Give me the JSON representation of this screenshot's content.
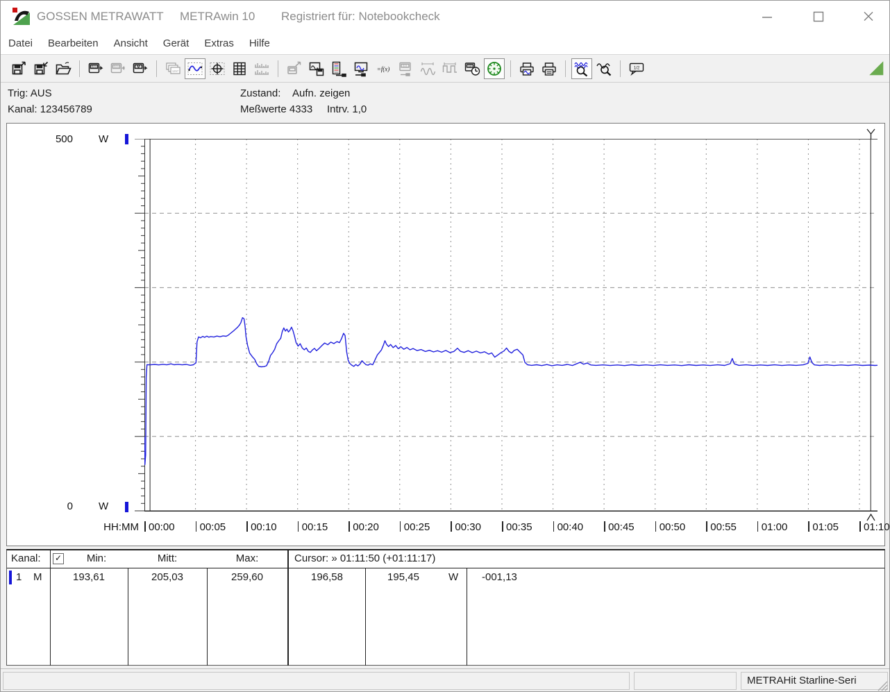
{
  "window": {
    "brand": "GOSSEN METRAWATT",
    "app_title": "METRAwin 10",
    "registered": "Registriert für: Notebookcheck"
  },
  "menu": {
    "items": [
      "Datei",
      "Bearbeiten",
      "Ansicht",
      "Gerät",
      "Extras",
      "Hilfe"
    ]
  },
  "toolbar": {
    "groups": [
      [
        {
          "name": "save-as",
          "icon": "disk_out",
          "state": "normal"
        },
        {
          "name": "save",
          "icon": "disk_in",
          "state": "normal"
        },
        {
          "name": "open",
          "icon": "folder",
          "state": "normal"
        }
      ],
      [
        {
          "name": "read-device",
          "icon": "dev321_out",
          "state": "normal"
        },
        {
          "name": "write-device",
          "icon": "dev321_in",
          "state": "disabled"
        },
        {
          "name": "read-memory",
          "icon": "devM",
          "state": "normal"
        }
      ],
      [
        {
          "name": "multi-display",
          "icon": "multidisp",
          "state": "disabled"
        },
        {
          "name": "curve-view",
          "icon": "curve",
          "state": "pressed"
        },
        {
          "name": "xy-view",
          "icon": "cross",
          "state": "normal"
        },
        {
          "name": "table-view",
          "icon": "table",
          "state": "normal"
        },
        {
          "name": "histogram-view",
          "icon": "hist",
          "state": "disabled"
        }
      ],
      [
        {
          "name": "export-device",
          "icon": "transfer",
          "state": "disabled"
        },
        {
          "name": "store-device",
          "icon": "store",
          "state": "normal"
        },
        {
          "name": "channel-setup",
          "icon": "chconf",
          "state": "normal"
        },
        {
          "name": "device-monitor",
          "icon": "monconf",
          "state": "normal"
        },
        {
          "name": "formula",
          "icon": "fx",
          "state": "normal"
        },
        {
          "name": "device-config",
          "icon": "dev321b",
          "state": "disabled"
        },
        {
          "name": "analog-trigger",
          "icon": "sine",
          "state": "disabled"
        },
        {
          "name": "pulse-trigger",
          "icon": "square",
          "state": "disabled"
        },
        {
          "name": "interval-clock",
          "icon": "clock",
          "state": "normal"
        },
        {
          "name": "live-gauge",
          "icon": "gauge",
          "state": "pressed"
        }
      ],
      [
        {
          "name": "print-preview",
          "icon": "printprev",
          "state": "normal"
        },
        {
          "name": "print",
          "icon": "print",
          "state": "normal"
        }
      ],
      [
        {
          "name": "zoom-in",
          "icon": "zoomin",
          "state": "pressed"
        },
        {
          "name": "zoom-out",
          "icon": "zoomout",
          "state": "normal"
        }
      ],
      [
        {
          "name": "value-callout",
          "icon": "callout",
          "state": "normal"
        }
      ]
    ],
    "corner_triangle_color": "#6aab4f"
  },
  "info": {
    "trig": "Trig: AUS",
    "kanal": "Kanal: 123456789",
    "zustand_label": "Zustand:",
    "zustand_value": "Aufn. zeigen",
    "messwerte": "Meßwerte 4333",
    "intervall": "Intrv. 1,0"
  },
  "chart_data": {
    "type": "line",
    "title": "",
    "xlabel": "HH:MM",
    "ylabel": "W",
    "unit": "W",
    "ylim": [
      0,
      500
    ],
    "y_top_label": "500",
    "y_bottom_label": "0",
    "grid": true,
    "x_total_min": 71.77,
    "x_tick_interval_min": 5,
    "x_ticks": [
      "00:00",
      "00:05",
      "00:10",
      "00:15",
      "00:20",
      "00:25",
      "00:30",
      "00:35",
      "00:40",
      "00:45",
      "00:50",
      "00:55",
      "01:00",
      "01:05",
      "01:10"
    ],
    "cursors_min": [
      0.55,
      71.1
    ],
    "series": [
      {
        "name": "Kanal 1 (M)",
        "color": "#2020dd",
        "points": [
          [
            0.0,
            100
          ],
          [
            0.05,
            62
          ],
          [
            0.12,
            75
          ],
          [
            0.18,
            180
          ],
          [
            0.25,
            196.5
          ],
          [
            0.6,
            196.3
          ],
          [
            1.0,
            196.8
          ],
          [
            1.4,
            196.2
          ],
          [
            1.8,
            196.9
          ],
          [
            2.2,
            196.3
          ],
          [
            2.6,
            197.6
          ],
          [
            2.9,
            196.4
          ],
          [
            3.3,
            196.9
          ],
          [
            3.7,
            196.3
          ],
          [
            4.1,
            196.8
          ],
          [
            4.5,
            195.6
          ],
          [
            4.8,
            196.4
          ],
          [
            5.05,
            199
          ],
          [
            5.15,
            227
          ],
          [
            5.3,
            233.8
          ],
          [
            5.5,
            232.6
          ],
          [
            5.7,
            234.4
          ],
          [
            5.9,
            233.2
          ],
          [
            6.1,
            234.8
          ],
          [
            6.3,
            233.4
          ],
          [
            6.5,
            234.2
          ],
          [
            6.8,
            233.6
          ],
          [
            7.1,
            234.9
          ],
          [
            7.4,
            234.0
          ],
          [
            7.7,
            235.2
          ],
          [
            8.0,
            234.6
          ],
          [
            8.2,
            236.0
          ],
          [
            8.45,
            238.8
          ],
          [
            8.7,
            241.5
          ],
          [
            8.9,
            244.0
          ],
          [
            9.1,
            246.5
          ],
          [
            9.3,
            249.5
          ],
          [
            9.45,
            253.0
          ],
          [
            9.6,
            259.6
          ],
          [
            9.75,
            258.2
          ],
          [
            9.85,
            249.0
          ],
          [
            9.95,
            234.0
          ],
          [
            10.1,
            222.5
          ],
          [
            10.3,
            212.0
          ],
          [
            10.55,
            207.5
          ],
          [
            10.8,
            203.5
          ],
          [
            11.0,
            197.5
          ],
          [
            11.2,
            194.0
          ],
          [
            11.45,
            193.6
          ],
          [
            11.7,
            193.8
          ],
          [
            11.95,
            195.0
          ],
          [
            12.15,
            200.5
          ],
          [
            12.35,
            209.0
          ],
          [
            12.55,
            212.5
          ],
          [
            12.75,
            217.0
          ],
          [
            12.95,
            224.5
          ],
          [
            13.15,
            228.5
          ],
          [
            13.35,
            232.0
          ],
          [
            13.5,
            241.0
          ],
          [
            13.65,
            245.8
          ],
          [
            13.8,
            241.6
          ],
          [
            13.95,
            244.2
          ],
          [
            14.1,
            240.4
          ],
          [
            14.25,
            242.8
          ],
          [
            14.4,
            246.8
          ],
          [
            14.55,
            242.0
          ],
          [
            14.7,
            234.5
          ],
          [
            14.85,
            226.0
          ],
          [
            15.05,
            221.5
          ],
          [
            15.25,
            224.6
          ],
          [
            15.45,
            219.0
          ],
          [
            15.65,
            216.4
          ],
          [
            15.85,
            218.8
          ],
          [
            16.05,
            214.2
          ],
          [
            16.25,
            213.0
          ],
          [
            16.45,
            216.2
          ],
          [
            16.65,
            218.4
          ],
          [
            16.85,
            215.2
          ],
          [
            17.05,
            217.6
          ],
          [
            17.35,
            221.8
          ],
          [
            17.65,
            225.6
          ],
          [
            17.95,
            223.2
          ],
          [
            18.25,
            226.8
          ],
          [
            18.55,
            224.8
          ],
          [
            18.85,
            227.4
          ],
          [
            19.1,
            226.0
          ],
          [
            19.3,
            231.5
          ],
          [
            19.5,
            238.6
          ],
          [
            19.65,
            235.5
          ],
          [
            19.8,
            214.0
          ],
          [
            19.95,
            202.5
          ],
          [
            20.1,
            198.2
          ],
          [
            20.3,
            195.8
          ],
          [
            20.5,
            194.2
          ],
          [
            20.7,
            196.6
          ],
          [
            20.9,
            194.8
          ],
          [
            21.1,
            197.2
          ],
          [
            21.3,
            201.8
          ],
          [
            21.5,
            198.8
          ],
          [
            21.7,
            196.4
          ],
          [
            21.9,
            195.8
          ],
          [
            22.1,
            197.6
          ],
          [
            22.35,
            196.4
          ],
          [
            22.6,
            203.5
          ],
          [
            22.8,
            209.5
          ],
          [
            23.0,
            212.8
          ],
          [
            23.2,
            216.2
          ],
          [
            23.4,
            222.8
          ],
          [
            23.55,
            228.6
          ],
          [
            23.7,
            224.0
          ],
          [
            23.9,
            220.8
          ],
          [
            24.1,
            223.6
          ],
          [
            24.35,
            219.4
          ],
          [
            24.6,
            222.2
          ],
          [
            24.85,
            218.0
          ],
          [
            25.1,
            220.6
          ],
          [
            25.4,
            217.2
          ],
          [
            25.7,
            219.6
          ],
          [
            26.0,
            216.4
          ],
          [
            26.3,
            218.2
          ],
          [
            26.7,
            215.4
          ],
          [
            27.1,
            216.8
          ],
          [
            27.5,
            214.2
          ],
          [
            27.9,
            215.8
          ],
          [
            28.3,
            213.6
          ],
          [
            28.7,
            215.2
          ],
          [
            29.1,
            213.2
          ],
          [
            29.5,
            215.6
          ],
          [
            29.9,
            212.8
          ],
          [
            30.3,
            214.2
          ],
          [
            30.65,
            218.6
          ],
          [
            30.95,
            214.4
          ],
          [
            31.3,
            213.0
          ],
          [
            31.7,
            215.2
          ],
          [
            32.1,
            212.6
          ],
          [
            32.5,
            214.6
          ],
          [
            32.9,
            212.2
          ],
          [
            33.3,
            213.8
          ],
          [
            33.7,
            210.6
          ],
          [
            34.0,
            212.2
          ],
          [
            34.3,
            206.5
          ],
          [
            34.6,
            209.5
          ],
          [
            34.9,
            212.5
          ],
          [
            35.2,
            214.8
          ],
          [
            35.45,
            218.8
          ],
          [
            35.7,
            214.2
          ],
          [
            35.95,
            212.0
          ],
          [
            36.2,
            215.6
          ],
          [
            36.5,
            217.2
          ],
          [
            36.8,
            213.0
          ],
          [
            37.05,
            209.5
          ],
          [
            37.25,
            199.5
          ],
          [
            37.5,
            196.4
          ],
          [
            37.9,
            195.5
          ],
          [
            38.4,
            196.4
          ],
          [
            38.9,
            195.2
          ],
          [
            39.4,
            196.6
          ],
          [
            39.9,
            195.1
          ],
          [
            40.4,
            196.3
          ],
          [
            40.9,
            195.5
          ],
          [
            41.4,
            196.8
          ],
          [
            41.9,
            195.3
          ],
          [
            42.3,
            197.6
          ],
          [
            42.65,
            199.6
          ],
          [
            43.0,
            197.1
          ],
          [
            43.35,
            198.6
          ],
          [
            43.7,
            196.1
          ],
          [
            44.2,
            195.5
          ],
          [
            44.9,
            196.2
          ],
          [
            45.6,
            195.3
          ],
          [
            46.3,
            196.1
          ],
          [
            47.0,
            195.2
          ],
          [
            47.7,
            196.4
          ],
          [
            48.4,
            195.4
          ],
          [
            49.1,
            196.2
          ],
          [
            49.8,
            195.3
          ],
          [
            50.5,
            196.3
          ],
          [
            51.2,
            195.5
          ],
          [
            51.9,
            196.1
          ],
          [
            52.6,
            195.2
          ],
          [
            53.3,
            196.4
          ],
          [
            54.0,
            195.4
          ],
          [
            54.7,
            196.1
          ],
          [
            55.4,
            195.3
          ],
          [
            56.1,
            196.3
          ],
          [
            56.8,
            195.4
          ],
          [
            57.35,
            197.8
          ],
          [
            57.55,
            204.8
          ],
          [
            57.75,
            197.6
          ],
          [
            58.2,
            195.5
          ],
          [
            58.9,
            196.3
          ],
          [
            59.6,
            195.3
          ],
          [
            60.3,
            196.1
          ],
          [
            61.0,
            195.4
          ],
          [
            61.7,
            196.3
          ],
          [
            62.4,
            195.3
          ],
          [
            63.1,
            196.1
          ],
          [
            63.8,
            195.5
          ],
          [
            64.5,
            196.3
          ],
          [
            64.95,
            198.2
          ],
          [
            65.15,
            206.8
          ],
          [
            65.35,
            199.2
          ],
          [
            65.6,
            196.2
          ],
          [
            66.1,
            195.4
          ],
          [
            66.8,
            196.2
          ],
          [
            67.5,
            195.3
          ],
          [
            68.2,
            196.1
          ],
          [
            68.9,
            195.4
          ],
          [
            69.6,
            196.3
          ],
          [
            70.3,
            195.4
          ],
          [
            71.0,
            195.9
          ],
          [
            71.5,
            195.4
          ],
          [
            71.8,
            195.6
          ]
        ]
      }
    ]
  },
  "table": {
    "kanal_header": "Kanal:",
    "min_header": "Min:",
    "mitt_header": "Mitt:",
    "max_header": "Max:",
    "cursor_header": "Cursor: » 01:11:50 (+01:11:17)",
    "checkbox": "✓",
    "row": {
      "channel": "1",
      "mode": "M",
      "min": "193,61",
      "mitt": "205,03",
      "max": "259,60",
      "cursor1": "196,58",
      "cursor2": "195,45",
      "unit": "W",
      "delta": "-001,13"
    }
  },
  "statusbar": {
    "device": "METRAHit Starline-Seri"
  }
}
